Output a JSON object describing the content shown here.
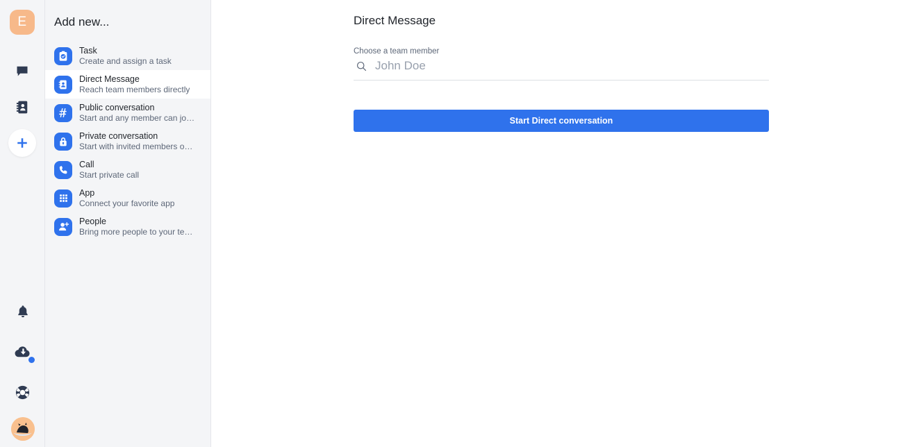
{
  "rail": {
    "logo_letter": "E",
    "icons": [
      {
        "name": "chat-icon",
        "label": "Chat"
      },
      {
        "name": "contacts-icon",
        "label": "Contacts"
      },
      {
        "name": "add-icon",
        "label": "Add new"
      },
      {
        "name": "bell-icon",
        "label": "Notifications"
      },
      {
        "name": "cloud-download-icon",
        "label": "Downloads"
      },
      {
        "name": "lifebuoy-icon",
        "label": "Help"
      },
      {
        "name": "avatar",
        "label": "User avatar"
      }
    ]
  },
  "panel": {
    "title": "Add new...",
    "items": [
      {
        "title": "Task",
        "subtitle": "Create and assign a task",
        "icon": "clipboard-check-icon",
        "active": false
      },
      {
        "title": "Direct Message",
        "subtitle": "Reach team members directly",
        "icon": "contact-card-icon",
        "active": true
      },
      {
        "title": "Public conversation",
        "subtitle": "Start and any member can jo…",
        "icon": "hash-icon",
        "active": false
      },
      {
        "title": "Private conversation",
        "subtitle": "Start with invited members o…",
        "icon": "lock-icon",
        "active": false
      },
      {
        "title": "Call",
        "subtitle": "Start private call",
        "icon": "phone-icon",
        "active": false
      },
      {
        "title": "App",
        "subtitle": "Connect your favorite app",
        "icon": "grid-apps-icon",
        "active": false
      },
      {
        "title": "People",
        "subtitle": "Bring more people to your te…",
        "icon": "person-add-icon",
        "active": false
      }
    ]
  },
  "main": {
    "title": "Direct Message",
    "field_label": "Choose a team member",
    "search_value": "",
    "search_placeholder": "John Doe",
    "search_icon": "search-icon",
    "submit_label": "Start Direct conversation"
  },
  "colors": {
    "accent": "#2f72ec",
    "sidebar_bg": "#f4f5f7",
    "logo_bg": "#f7b98a",
    "text_primary": "#1f2329",
    "text_secondary": "#5d6778"
  }
}
